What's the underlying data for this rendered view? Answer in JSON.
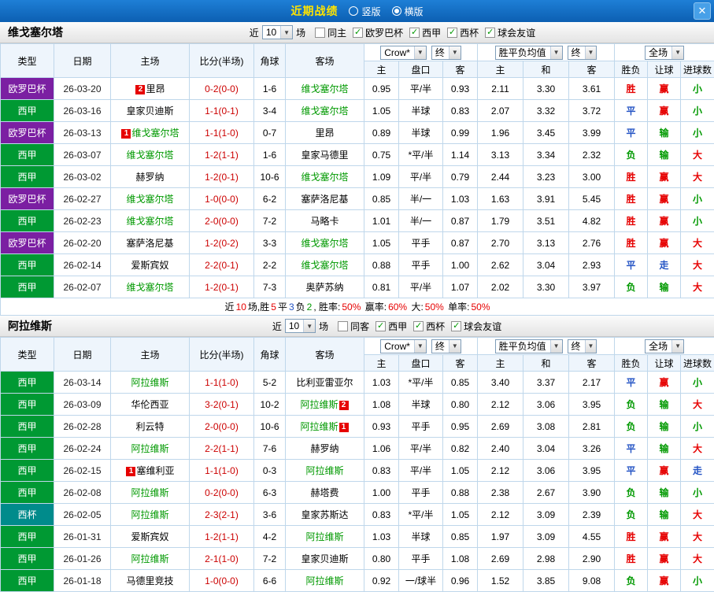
{
  "icons": {
    "chevron_down": "▼",
    "close": "✕"
  },
  "colors": {
    "header_blue": "#0c5fb2",
    "title_yellow": "#ffe400",
    "league_europa": "#7b1fa2",
    "league_laliga": "#009933",
    "league_cup": "#008b8b",
    "focus_team_green": "#009900",
    "score_red": "#cc0000",
    "win_red": "#e60000",
    "draw_blue": "#2353c4",
    "lose_green": "#009900"
  },
  "topbar": {
    "title": "近期战绩",
    "vertical_label": "竖版",
    "horizontal_label": "横版"
  },
  "sections": [
    {
      "team": "维戈塞尔塔",
      "near_label": "近",
      "count": "10",
      "games_label": "场",
      "checkboxes": [
        {
          "label": "同主",
          "checked": false
        },
        {
          "label": "欧罗巴杯",
          "checked": true
        },
        {
          "label": "西甲",
          "checked": true
        },
        {
          "label": "西杯",
          "checked": true
        },
        {
          "label": "球会友谊",
          "checked": true
        }
      ],
      "filters": {
        "book": "Crow*",
        "book_state": "终",
        "eu_label": "胜平负均值",
        "eu_state": "终",
        "scope": "全场"
      },
      "columns": {
        "type": "类型",
        "date": "日期",
        "home": "主场",
        "score": "比分(半场)",
        "corner": "角球",
        "away": "客场",
        "ah_home": "主",
        "ah_line": "盘口",
        "ah_away": "客",
        "eu_home": "主",
        "eu_draw": "和",
        "eu_away": "客",
        "res_wdl": "胜负",
        "res_ah": "让球",
        "res_ou": "进球数"
      },
      "rows": [
        {
          "league": "欧罗巴杯",
          "league_bg": "#7b1fa2",
          "date": "26-03-20",
          "home": "里昂",
          "home_card_pre": "2",
          "score": "0-2(0-0)",
          "corners": "1-6",
          "away": "维戈塞尔塔",
          "away_focus": true,
          "ah_h": "0.95",
          "ah": "平/半",
          "ah_a": "0.93",
          "eu_h": "2.11",
          "eu_d": "3.30",
          "eu_a": "3.61",
          "r1": "胜",
          "r1c": "r",
          "r2": "赢",
          "r2c": "r",
          "r3": "小",
          "r3c": "g"
        },
        {
          "league": "西甲",
          "league_bg": "#009933",
          "date": "26-03-16",
          "home": "皇家贝迪斯",
          "score": "1-1(0-1)",
          "corners": "3-4",
          "away": "维戈塞尔塔",
          "away_focus": true,
          "ah_h": "1.05",
          "ah": "半球",
          "ah_a": "0.83",
          "eu_h": "2.07",
          "eu_d": "3.32",
          "eu_a": "3.72",
          "r1": "平",
          "r1c": "b",
          "r2": "赢",
          "r2c": "r",
          "r3": "小",
          "r3c": "g"
        },
        {
          "league": "欧罗巴杯",
          "league_bg": "#7b1fa2",
          "date": "26-03-13",
          "home": "维戈塞尔塔",
          "home_card_pre": "1",
          "home_focus": true,
          "score": "1-1(1-0)",
          "corners": "0-7",
          "away": "里昂",
          "ah_h": "0.89",
          "ah": "半球",
          "ah_a": "0.99",
          "eu_h": "1.96",
          "eu_d": "3.45",
          "eu_a": "3.99",
          "r1": "平",
          "r1c": "b",
          "r2": "输",
          "r2c": "g",
          "r3": "小",
          "r3c": "g"
        },
        {
          "league": "西甲",
          "league_bg": "#009933",
          "date": "26-03-07",
          "home": "维戈塞尔塔",
          "home_focus": true,
          "score": "1-2(1-1)",
          "corners": "1-6",
          "away": "皇家马德里",
          "ah_h": "0.75",
          "ah": "*平/半",
          "ah_a": "1.14",
          "eu_h": "3.13",
          "eu_d": "3.34",
          "eu_a": "2.32",
          "r1": "负",
          "r1c": "g",
          "r2": "输",
          "r2c": "g",
          "r3": "大",
          "r3c": "r"
        },
        {
          "league": "西甲",
          "league_bg": "#009933",
          "date": "26-03-02",
          "home": "赫罗纳",
          "score": "1-2(0-1)",
          "corners": "10-6",
          "away": "维戈塞尔塔",
          "away_focus": true,
          "ah_h": "1.09",
          "ah": "平/半",
          "ah_a": "0.79",
          "eu_h": "2.44",
          "eu_d": "3.23",
          "eu_a": "3.00",
          "r1": "胜",
          "r1c": "r",
          "r2": "赢",
          "r2c": "r",
          "r3": "大",
          "r3c": "r"
        },
        {
          "league": "欧罗巴杯",
          "league_bg": "#7b1fa2",
          "date": "26-02-27",
          "home": "维戈塞尔塔",
          "home_focus": true,
          "score": "1-0(0-0)",
          "corners": "6-2",
          "away": "塞萨洛尼基",
          "ah_h": "0.85",
          "ah": "半/一",
          "ah_a": "1.03",
          "eu_h": "1.63",
          "eu_d": "3.91",
          "eu_a": "5.45",
          "r1": "胜",
          "r1c": "r",
          "r2": "赢",
          "r2c": "r",
          "r3": "小",
          "r3c": "g"
        },
        {
          "league": "西甲",
          "league_bg": "#009933",
          "date": "26-02-23",
          "home": "维戈塞尔塔",
          "home_focus": true,
          "score": "2-0(0-0)",
          "corners": "7-2",
          "away": "马略卡",
          "ah_h": "1.01",
          "ah": "半/一",
          "ah_a": "0.87",
          "eu_h": "1.79",
          "eu_d": "3.51",
          "eu_a": "4.82",
          "r1": "胜",
          "r1c": "r",
          "r2": "赢",
          "r2c": "r",
          "r3": "小",
          "r3c": "g"
        },
        {
          "league": "欧罗巴杯",
          "league_bg": "#7b1fa2",
          "date": "26-02-20",
          "home": "塞萨洛尼基",
          "score": "1-2(0-2)",
          "corners": "3-3",
          "away": "维戈塞尔塔",
          "away_focus": true,
          "ah_h": "1.05",
          "ah": "平手",
          "ah_a": "0.87",
          "eu_h": "2.70",
          "eu_d": "3.13",
          "eu_a": "2.76",
          "r1": "胜",
          "r1c": "r",
          "r2": "赢",
          "r2c": "r",
          "r3": "大",
          "r3c": "r"
        },
        {
          "league": "西甲",
          "league_bg": "#009933",
          "date": "26-02-14",
          "home": "爱斯宾奴",
          "score": "2-2(0-1)",
          "corners": "2-2",
          "away": "维戈塞尔塔",
          "away_focus": true,
          "ah_h": "0.88",
          "ah": "平手",
          "ah_a": "1.00",
          "eu_h": "2.62",
          "eu_d": "3.04",
          "eu_a": "2.93",
          "r1": "平",
          "r1c": "b",
          "r2": "走",
          "r2c": "b",
          "r3": "大",
          "r3c": "r"
        },
        {
          "league": "西甲",
          "league_bg": "#009933",
          "date": "26-02-07",
          "home": "维戈塞尔塔",
          "home_focus": true,
          "score": "1-2(0-1)",
          "corners": "7-3",
          "away": "奥萨苏纳",
          "ah_h": "0.81",
          "ah": "平/半",
          "ah_a": "1.07",
          "eu_h": "2.02",
          "eu_d": "3.30",
          "eu_a": "3.97",
          "r1": "负",
          "r1c": "g",
          "r2": "输",
          "r2c": "g",
          "r3": "大",
          "r3c": "r"
        }
      ],
      "summary": [
        {
          "t": "近",
          "c": "k"
        },
        {
          "t": "10",
          "c": "r"
        },
        {
          "t": "场,胜",
          "c": "k"
        },
        {
          "t": "5",
          "c": "r"
        },
        {
          "t": "平",
          "c": "k"
        },
        {
          "t": "3",
          "c": "b"
        },
        {
          "t": "负",
          "c": "k"
        },
        {
          "t": "2",
          "c": "g"
        },
        {
          "t": ", 胜率:",
          "c": "k"
        },
        {
          "t": "50%",
          "c": "r"
        },
        {
          "t": " 赢率:",
          "c": "k"
        },
        {
          "t": "60%",
          "c": "r"
        },
        {
          "t": " 大:",
          "c": "k"
        },
        {
          "t": "50%",
          "c": "r"
        },
        {
          "t": " 单率:",
          "c": "k"
        },
        {
          "t": "50%",
          "c": "r"
        }
      ]
    },
    {
      "team": "阿拉维斯",
      "near_label": "近",
      "count": "10",
      "games_label": "场",
      "checkboxes": [
        {
          "label": "同客",
          "checked": false
        },
        {
          "label": "西甲",
          "checked": true
        },
        {
          "label": "西杯",
          "checked": true
        },
        {
          "label": "球会友谊",
          "checked": true
        }
      ],
      "filters": {
        "book": "Crow*",
        "book_state": "终",
        "eu_label": "胜平负均值",
        "eu_state": "终",
        "scope": "全场"
      },
      "columns": {
        "type": "类型",
        "date": "日期",
        "home": "主场",
        "score": "比分(半场)",
        "corner": "角球",
        "away": "客场",
        "ah_home": "主",
        "ah_line": "盘口",
        "ah_away": "客",
        "eu_home": "主",
        "eu_draw": "和",
        "eu_away": "客",
        "res_wdl": "胜负",
        "res_ah": "让球",
        "res_ou": "进球数"
      },
      "rows": [
        {
          "league": "西甲",
          "league_bg": "#009933",
          "date": "26-03-14",
          "home": "阿拉维斯",
          "home_focus": true,
          "score": "1-1(1-0)",
          "corners": "5-2",
          "away": "比利亚雷亚尔",
          "ah_h": "1.03",
          "ah": "*平/半",
          "ah_a": "0.85",
          "eu_h": "3.40",
          "eu_d": "3.37",
          "eu_a": "2.17",
          "r1": "平",
          "r1c": "b",
          "r2": "赢",
          "r2c": "r",
          "r3": "小",
          "r3c": "g"
        },
        {
          "league": "西甲",
          "league_bg": "#009933",
          "date": "26-03-09",
          "home": "华伦西亚",
          "score": "3-2(0-1)",
          "corners": "10-2",
          "away": "阿拉维斯",
          "away_focus": true,
          "away_card_post": "2",
          "ah_h": "1.08",
          "ah": "半球",
          "ah_a": "0.80",
          "eu_h": "2.12",
          "eu_d": "3.06",
          "eu_a": "3.95",
          "r1": "负",
          "r1c": "g",
          "r2": "输",
          "r2c": "g",
          "r3": "大",
          "r3c": "r"
        },
        {
          "league": "西甲",
          "league_bg": "#009933",
          "date": "26-02-28",
          "home": "利云特",
          "score": "2-0(0-0)",
          "corners": "10-6",
          "away": "阿拉维斯",
          "away_focus": true,
          "away_card_post": "1",
          "ah_h": "0.93",
          "ah": "平手",
          "ah_a": "0.95",
          "eu_h": "2.69",
          "eu_d": "3.08",
          "eu_a": "2.81",
          "r1": "负",
          "r1c": "g",
          "r2": "输",
          "r2c": "g",
          "r3": "小",
          "r3c": "g"
        },
        {
          "league": "西甲",
          "league_bg": "#009933",
          "date": "26-02-24",
          "home": "阿拉维斯",
          "home_focus": true,
          "score": "2-2(1-1)",
          "corners": "7-6",
          "away": "赫罗纳",
          "ah_h": "1.06",
          "ah": "平/半",
          "ah_a": "0.82",
          "eu_h": "2.40",
          "eu_d": "3.04",
          "eu_a": "3.26",
          "r1": "平",
          "r1c": "b",
          "r2": "输",
          "r2c": "g",
          "r3": "大",
          "r3c": "r"
        },
        {
          "league": "西甲",
          "league_bg": "#009933",
          "date": "26-02-15",
          "home": "塞维利亚",
          "home_card_pre": "1",
          "score": "1-1(1-0)",
          "corners": "0-3",
          "away": "阿拉维斯",
          "away_focus": true,
          "ah_h": "0.83",
          "ah": "平/半",
          "ah_a": "1.05",
          "eu_h": "2.12",
          "eu_d": "3.06",
          "eu_a": "3.95",
          "r1": "平",
          "r1c": "b",
          "r2": "赢",
          "r2c": "r",
          "r3": "走",
          "r3c": "b"
        },
        {
          "league": "西甲",
          "league_bg": "#009933",
          "date": "26-02-08",
          "home": "阿拉维斯",
          "home_focus": true,
          "score": "0-2(0-0)",
          "corners": "6-3",
          "away": "赫塔费",
          "ah_h": "1.00",
          "ah": "平手",
          "ah_a": "0.88",
          "eu_h": "2.38",
          "eu_d": "2.67",
          "eu_a": "3.90",
          "r1": "负",
          "r1c": "g",
          "r2": "输",
          "r2c": "g",
          "r3": "小",
          "r3c": "g"
        },
        {
          "league": "西杯",
          "league_bg": "#008b8b",
          "date": "26-02-05",
          "home": "阿拉维斯",
          "home_focus": true,
          "score": "2-3(2-1)",
          "corners": "3-6",
          "away": "皇家苏斯达",
          "ah_h": "0.83",
          "ah": "*平/半",
          "ah_a": "1.05",
          "eu_h": "2.12",
          "eu_d": "3.09",
          "eu_a": "2.39",
          "r1": "负",
          "r1c": "g",
          "r2": "输",
          "r2c": "g",
          "r3": "大",
          "r3c": "r"
        },
        {
          "league": "西甲",
          "league_bg": "#009933",
          "date": "26-01-31",
          "home": "爱斯宾奴",
          "score": "1-2(1-1)",
          "corners": "4-2",
          "away": "阿拉维斯",
          "away_focus": true,
          "ah_h": "1.03",
          "ah": "半球",
          "ah_a": "0.85",
          "eu_h": "1.97",
          "eu_d": "3.09",
          "eu_a": "4.55",
          "r1": "胜",
          "r1c": "r",
          "r2": "赢",
          "r2c": "r",
          "r3": "大",
          "r3c": "r"
        },
        {
          "league": "西甲",
          "league_bg": "#009933",
          "date": "26-01-26",
          "home": "阿拉维斯",
          "home_focus": true,
          "score": "2-1(1-0)",
          "corners": "7-2",
          "away": "皇家贝迪斯",
          "ah_h": "0.80",
          "ah": "平手",
          "ah_a": "1.08",
          "eu_h": "2.69",
          "eu_d": "2.98",
          "eu_a": "2.90",
          "r1": "胜",
          "r1c": "r",
          "r2": "赢",
          "r2c": "r",
          "r3": "大",
          "r3c": "r"
        },
        {
          "league": "西甲",
          "league_bg": "#009933",
          "date": "26-01-18",
          "home": "马德里竞技",
          "score": "1-0(0-0)",
          "corners": "6-6",
          "away": "阿拉维斯",
          "away_focus": true,
          "ah_h": "0.92",
          "ah": "一/球半",
          "ah_a": "0.96",
          "eu_h": "1.52",
          "eu_d": "3.85",
          "eu_a": "9.08",
          "r1": "负",
          "r1c": "g",
          "r2": "赢",
          "r2c": "r",
          "r3": "小",
          "r3c": "g"
        }
      ],
      "summary": []
    }
  ]
}
